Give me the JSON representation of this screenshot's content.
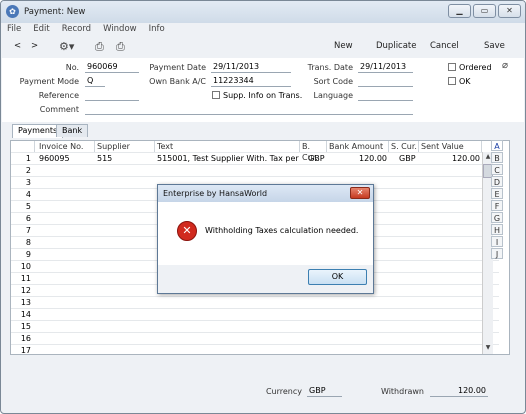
{
  "window": {
    "title": "Payment: New"
  },
  "menu": [
    "File",
    "Edit",
    "Record",
    "Window",
    "Info"
  ],
  "toolbar": {
    "prev": "<",
    "next": ">",
    "new": "New",
    "duplicate": "Duplicate",
    "cancel": "Cancel",
    "save": "Save"
  },
  "header": {
    "no_label": "No.",
    "no": "960069",
    "payment_date_label": "Payment Date",
    "payment_date": "29/11/2013",
    "trans_date_label": "Trans. Date",
    "trans_date": "29/11/2013",
    "payment_mode_label": "Payment Mode",
    "payment_mode": "Q",
    "own_bank_label": "Own Bank A/C",
    "own_bank": "11223344",
    "sort_code_label": "Sort Code",
    "sort_code": "",
    "reference_label": "Reference",
    "reference": "",
    "supp_info_label": "Supp. Info on Trans.",
    "language_label": "Language",
    "language": "",
    "comment_label": "Comment",
    "comment": "",
    "ordered_label": "Ordered",
    "ok_label": "OK"
  },
  "tabs": [
    {
      "label": "Payments"
    },
    {
      "label": "Bank"
    }
  ],
  "matrix": {
    "columns": [
      "Invoice No.",
      "Supplier",
      "Text",
      "B. Cur.",
      "Bank Amount",
      "S. Cur.",
      "Sent Value"
    ],
    "rows": [
      {
        "num": "1",
        "invoice": "960095",
        "supplier": "515",
        "text": "515001, Test Supplier With. Tax per Inv",
        "bcur": "GBP",
        "bank_amount": "120.00",
        "scur": "GBP",
        "sent_value": "120.00"
      },
      {
        "num": "2"
      },
      {
        "num": "3"
      },
      {
        "num": "4"
      },
      {
        "num": "5"
      },
      {
        "num": "6"
      },
      {
        "num": "7"
      },
      {
        "num": "8"
      },
      {
        "num": "9"
      },
      {
        "num": "10"
      },
      {
        "num": "11"
      },
      {
        "num": "12"
      },
      {
        "num": "13"
      },
      {
        "num": "14"
      },
      {
        "num": "15"
      },
      {
        "num": "16"
      },
      {
        "num": "17"
      }
    ]
  },
  "letters": [
    "A",
    "B",
    "C",
    "D",
    "E",
    "F",
    "G",
    "H",
    "I",
    "J"
  ],
  "footer": {
    "currency_label": "Currency",
    "currency": "GBP",
    "withdrawn_label": "Withdrawn",
    "withdrawn": "120.00"
  },
  "dialog": {
    "title": "Enterprise by HansaWorld",
    "message": "Withholding Taxes calculation needed.",
    "ok": "OK"
  }
}
